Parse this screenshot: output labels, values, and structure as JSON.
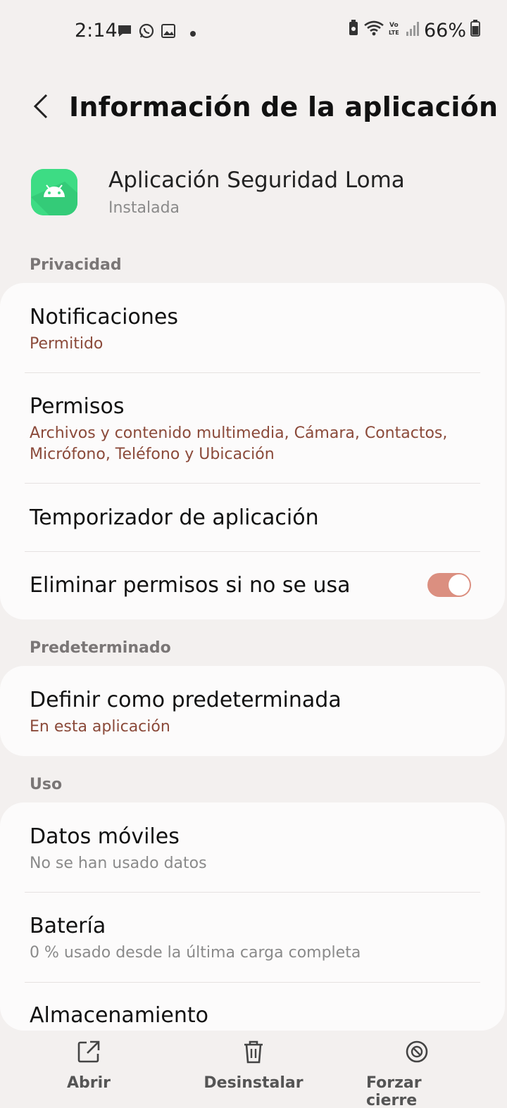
{
  "status_bar": {
    "time": "2:14",
    "battery": "66%",
    "icons_left": [
      "message-icon",
      "whatsapp-icon",
      "gallery-icon",
      "dot-icon"
    ],
    "icons_right": [
      "battery-saver-icon",
      "wifi-icon",
      "volte-icon",
      "signal-icon",
      "battery-icon"
    ]
  },
  "header": {
    "title": "Información de la aplicación",
    "back_icon": "chevron-left-icon"
  },
  "app": {
    "name": "Aplicación Seguridad Loma",
    "status": "Instalada",
    "icon": "android-icon",
    "icon_color": "#3ddc84"
  },
  "sections": {
    "privacidad": {
      "header": "Privacidad",
      "notificaciones": {
        "title": "Notificaciones",
        "subtitle": "Permitido"
      },
      "permisos": {
        "title": "Permisos",
        "subtitle_line1": "Archivos y contenido multimedia, Cámara, Contactos,",
        "subtitle_line2": "Micrófono, Teléfono y Ubicación"
      },
      "temporizador": {
        "title": "Temporizador de aplicación"
      },
      "eliminar": {
        "title": "Eliminar permisos si no se usa",
        "toggle_on": true
      }
    },
    "predeterminado": {
      "header": "Predeterminado",
      "definir": {
        "title": "Definir como predeterminada",
        "subtitle": "En esta aplicación"
      }
    },
    "uso": {
      "header": "Uso",
      "datos": {
        "title": "Datos móviles",
        "subtitle": "No se han usado datos"
      },
      "bateria": {
        "title": "Batería",
        "subtitle": "0 % usado desde la última carga completa"
      },
      "almacenamiento": {
        "title": "Almacenamiento"
      }
    }
  },
  "bottom_bar": {
    "abrir": "Abrir",
    "desinstalar": "Desinstalar",
    "forzar": "Forzar cierre"
  },
  "colors": {
    "accent": "#8b4a3a",
    "toggle": "#db8f80",
    "background": "#f3f0ef",
    "card": "#fcfbfb"
  }
}
